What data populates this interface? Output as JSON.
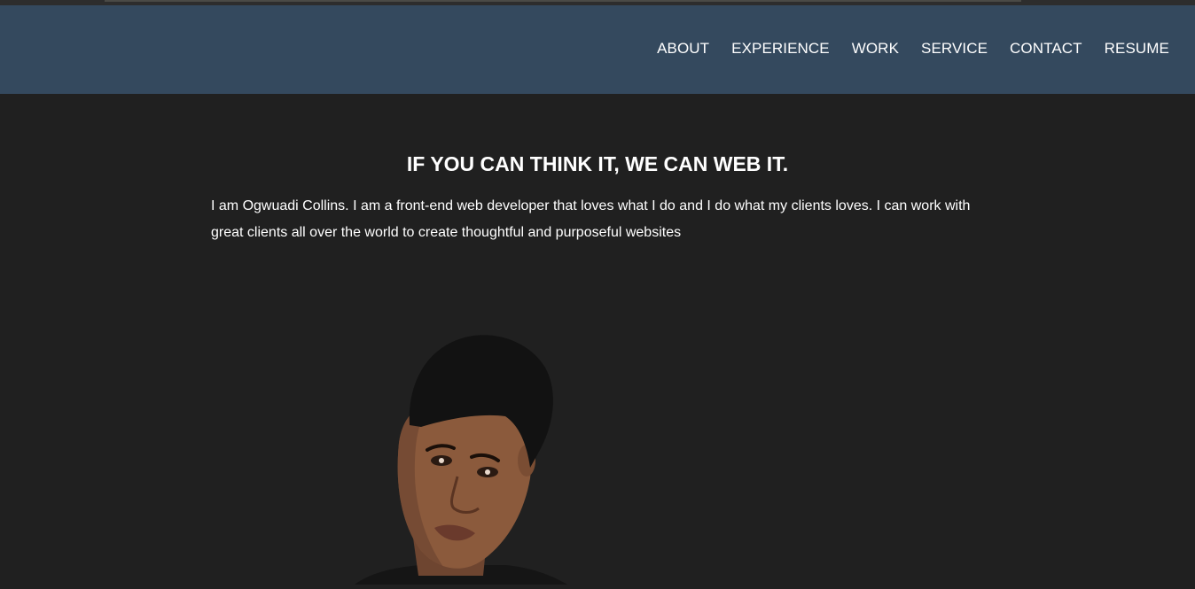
{
  "nav": {
    "items": [
      {
        "label": "ABOUT"
      },
      {
        "label": "EXPERIENCE"
      },
      {
        "label": "WORK"
      },
      {
        "label": "SERVICE"
      },
      {
        "label": "CONTACT"
      },
      {
        "label": "RESUME"
      }
    ]
  },
  "hero": {
    "title": "IF YOU CAN THINK IT, WE CAN WEB IT.",
    "text": "I am Ogwuadi Collins. I am a front-end web developer that loves what I do and I do what my clients loves. I can work with great clients all over the world to create thoughtful and purposeful websites"
  },
  "colors": {
    "navbar": "#34495e",
    "background": "#202020",
    "text": "#ffffff"
  }
}
